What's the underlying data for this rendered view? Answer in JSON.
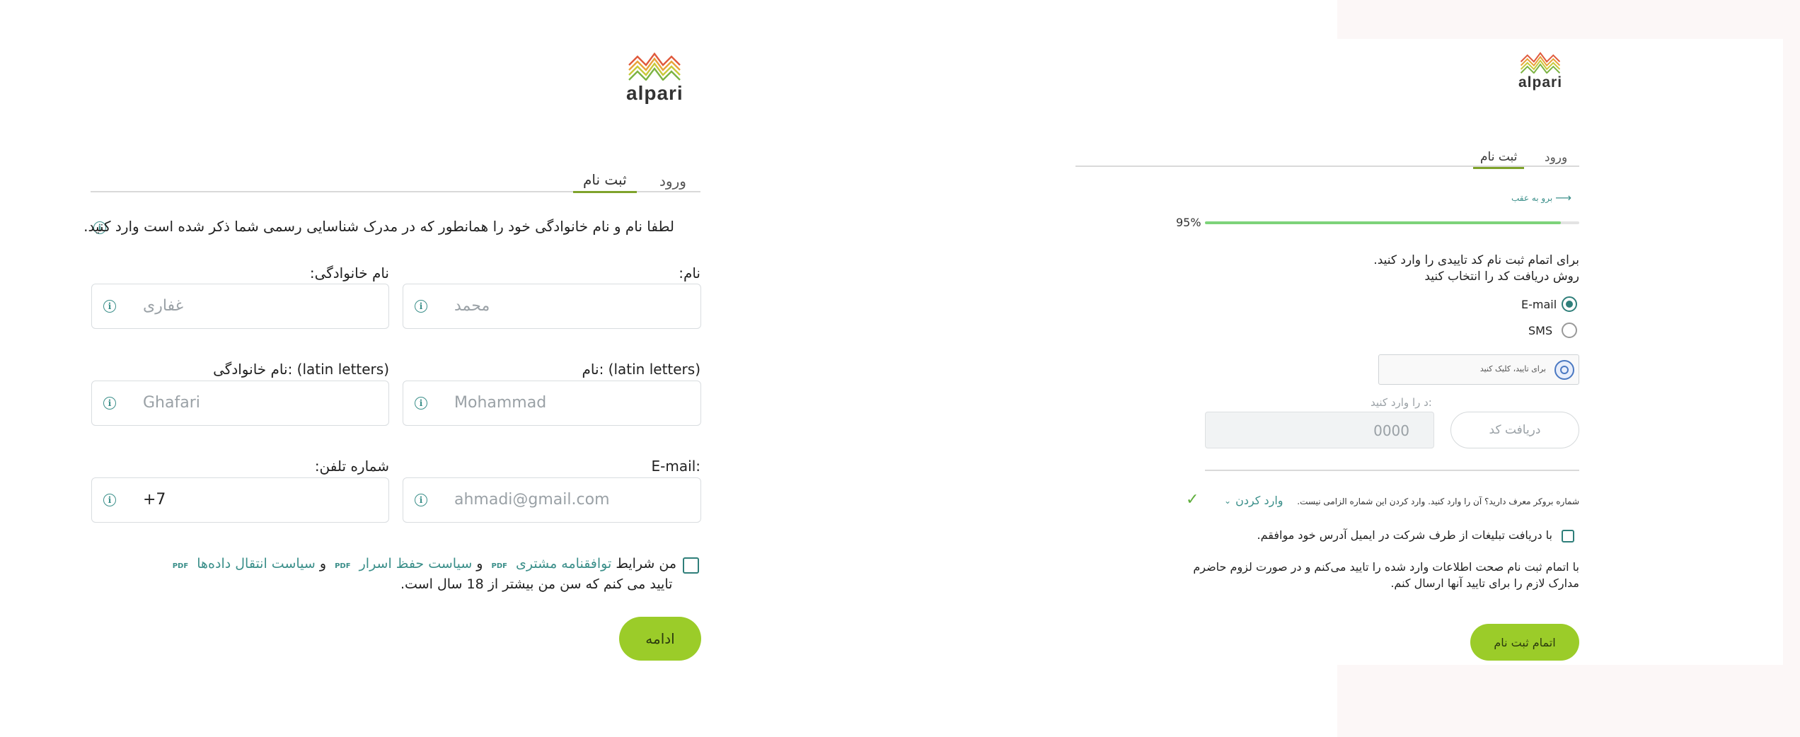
{
  "left": {
    "logo_text": "alpari",
    "tabs": {
      "login": "ورود",
      "register": "ثبت نام"
    },
    "instruction": "لطفا نام و نام خانوادگی خود را همانطور که در مدرک شناسایی رسمی شما ذکر شده است وارد کنید.",
    "fields": {
      "first_name": {
        "label": "نام:",
        "placeholder": "محمد"
      },
      "last_name": {
        "label": "نام خانوادگی:",
        "placeholder": "غفاری"
      },
      "first_name_latin": {
        "label": "نام: (latin letters)",
        "placeholder": "Mohammad"
      },
      "last_name_latin": {
        "label": "نام خانوادگی: (latin letters)",
        "placeholder": "Ghafari"
      },
      "email": {
        "label": "E-mail:",
        "placeholder": "ahmadi@gmail.com"
      },
      "phone": {
        "label": "شماره تلفن:",
        "value": "+7"
      }
    },
    "agreement": {
      "prefix": "من شرایط",
      "link1": "توافقنامه مشتری",
      "and1": "و",
      "link2": "سیاست حفظ اسرار",
      "and2": "و",
      "link3": "سیاست انتقال داده‌ها",
      "pdf": "PDF",
      "line2": ".تایید می کنم که سن من بیشتر از 18 سال است"
    },
    "continue_button": "ادامه"
  },
  "right": {
    "logo_text": "alpari",
    "tabs": {
      "login": "ورود",
      "register": "ثبت نام"
    },
    "back_link": "برو به عقب",
    "progress_label": "95%",
    "progress_value": 95,
    "instruction_line1": "برای اتمام ثبت نام کد تاییدی را وارد کنید.",
    "instruction_line2": "روش دریافت کد را انتخاب کنید",
    "options": {
      "email": "E-mail",
      "sms": "SMS"
    },
    "captcha_text": "برای تایید، کلیک کنید",
    "code_label": "د را وارد کنید:",
    "code_placeholder": "0000",
    "get_code_button": "دریافت کد",
    "referral_text": "شماره بروکر معرف دارید؟ آن را وارد کنید. وارد کردن این شماره الزامی نیست.",
    "referral_link": "وارد کردن",
    "ads_consent": "با دریافت تبلیغات از طرف شرکت در ایمیل آدرس خود موافقم.",
    "confirm_line1": "با اتمام ثبت نام صحت اطلاعات وارد شده را تایید می‌کنم و در صورت لزوم حاضرم",
    "confirm_line2": "مدارک لازم را برای تایید آنها ارسال کنم.",
    "finish_button": "اتمام ثبت نام"
  },
  "colors": {
    "accent_green": "#9bcc29",
    "teal": "#3b8f8a",
    "tab_underline": "#7fa32c"
  }
}
